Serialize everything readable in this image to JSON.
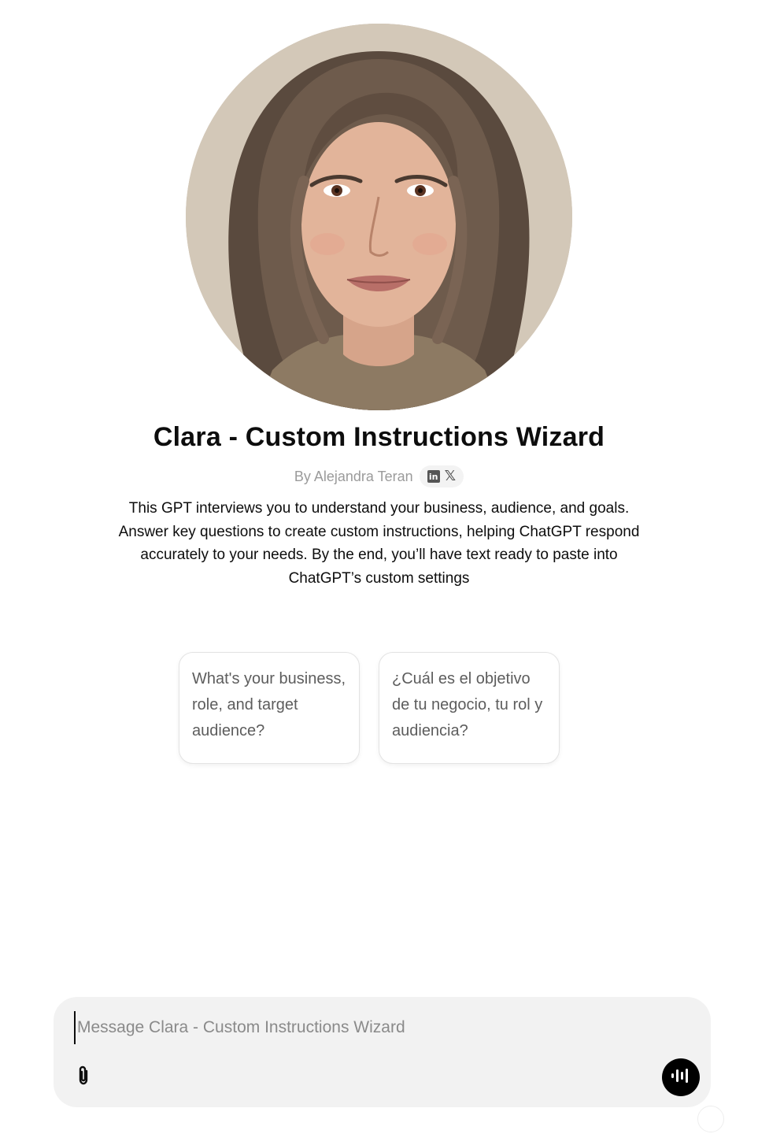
{
  "gpt": {
    "name": "Clara - Custom Instructions Wizard",
    "author": "By Alejandra Teran",
    "social_icons": [
      "linkedin-icon",
      "x-icon"
    ],
    "description": "This GPT interviews you to understand your business, audience, and goals. Answer key questions to create custom instructions, helping ChatGPT respond accurately to your needs. By the end, you’ll have text ready to paste into ChatGPT’s custom settings"
  },
  "starters": [
    "What's your business, role, and target audience?",
    "¿Cuál es el objetivo de tu negocio, tu rol y audiencia?"
  ],
  "composer": {
    "placeholder": "Message Clara - Custom Instructions Wizard",
    "value": "",
    "attach_icon": "paperclip-icon",
    "voice_icon": "voice-waveform-icon"
  },
  "colors": {
    "voice_button": "#000000",
    "composer_bg": "#f2f2f2",
    "muted_text": "#9b9b9b"
  }
}
